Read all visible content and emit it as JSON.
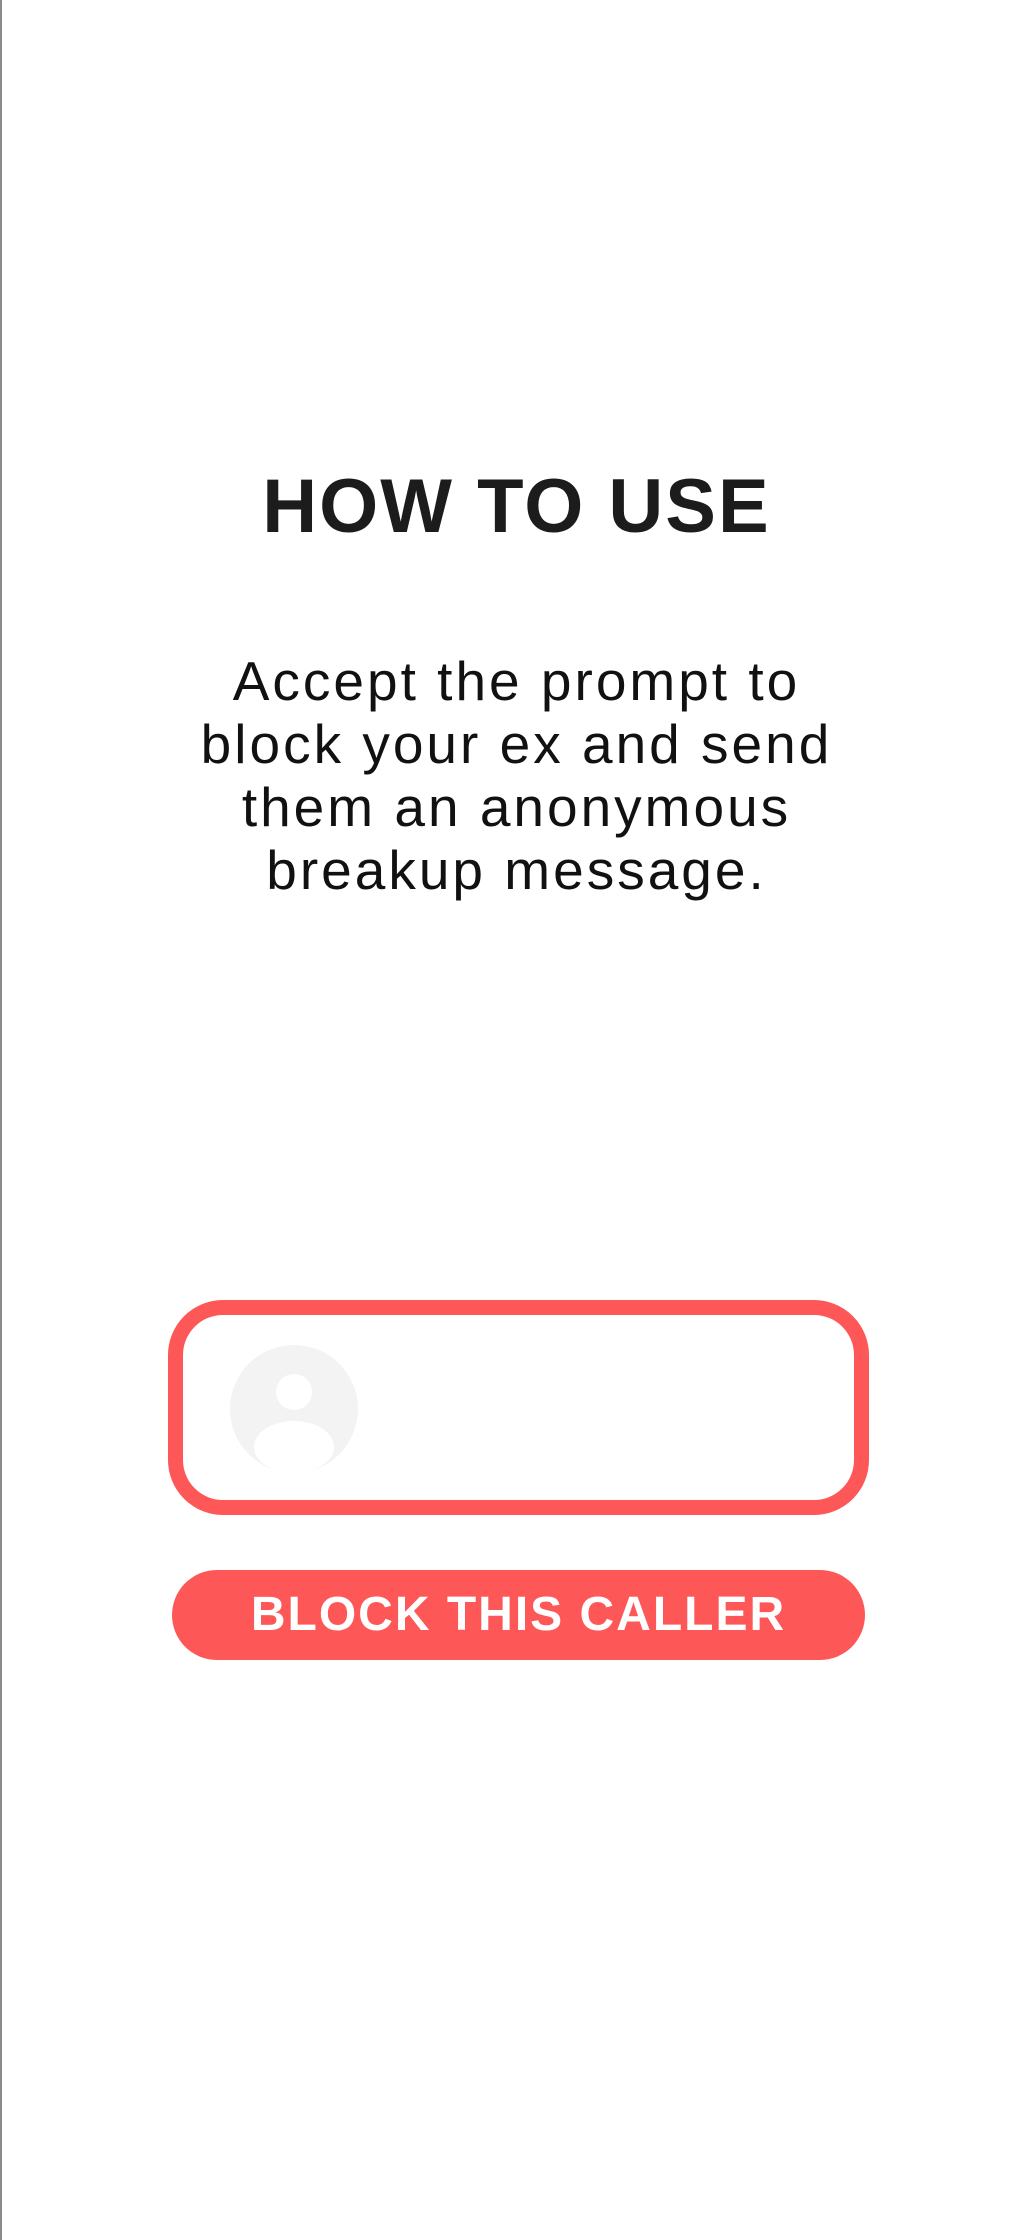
{
  "header": {
    "title": "HOW TO USE"
  },
  "main": {
    "instructions": "Accept the prompt to block your ex and send them an anonymous breakup message."
  },
  "caller_card": {
    "avatar_icon": "person-silhouette-icon"
  },
  "actions": {
    "block_label": "BLOCK THIS CALLER"
  },
  "colors": {
    "accent": "#fe5757",
    "title_text": "#1c1c1c",
    "avatar_bg": "#f3f3f3",
    "avatar_figure": "#ffffff"
  }
}
